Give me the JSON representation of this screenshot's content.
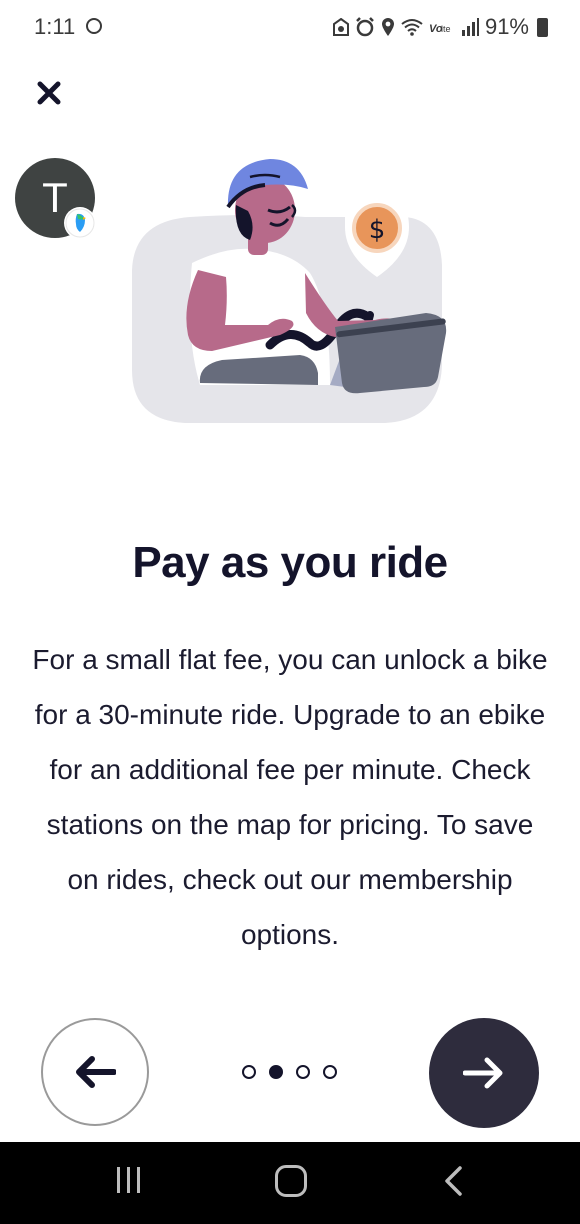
{
  "status_bar": {
    "time": "1:11",
    "battery_percent": "91%",
    "icons": [
      "globe-icon",
      "sync-icon",
      "alarm-icon",
      "location-icon",
      "wifi-icon",
      "volte-icon",
      "signal-icon",
      "battery-icon"
    ]
  },
  "header": {
    "close_icon": "close-icon",
    "avatar_letter": "T"
  },
  "onboarding": {
    "title": "Pay as you ride",
    "description": "For a small flat fee, you can unlock a bike for a 30-minute ride. Upgrade to an ebike for an additional fee per minute. Check stations on the map for pricing. To save on rides, check out our membership options.",
    "page_indicator": {
      "total": 4,
      "current": 2
    }
  },
  "colors": {
    "title": "#14142b",
    "next_button": "#2e2c3d",
    "coin": "#e8955a",
    "helmet": "#6f86e0",
    "skin": "#b76a8a"
  },
  "nav_bar": {
    "icons": [
      "recents-icon",
      "home-icon",
      "back-icon"
    ]
  }
}
